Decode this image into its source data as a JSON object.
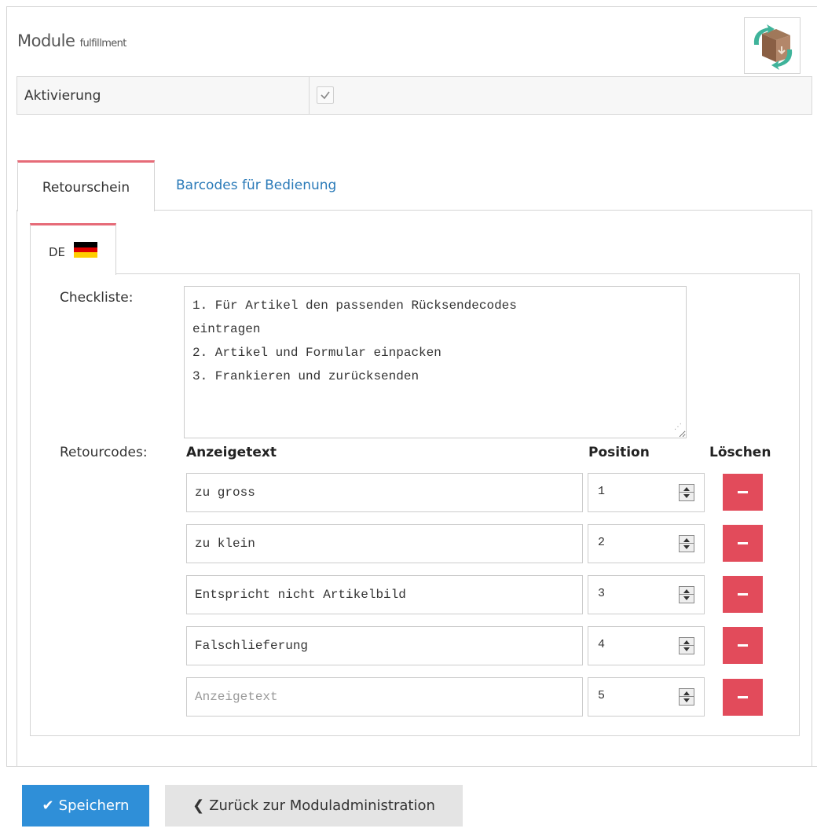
{
  "header": {
    "title": "Module",
    "subtitle": "fulfillment",
    "logo_icon": "package-return-icon"
  },
  "activation": {
    "label": "Aktivierung",
    "checked": true,
    "check_glyph": "✓"
  },
  "tabs": [
    {
      "label": "Retourschein",
      "active": true
    },
    {
      "label": "Barcodes für Bedienung",
      "active": false
    }
  ],
  "language_tab": {
    "label": "DE",
    "flag_colors": [
      "#000000",
      "#dd0000",
      "#ffce00"
    ]
  },
  "checklist": {
    "label": "Checkliste:",
    "value": "1. Für Artikel den passenden Rücksendecodes\neintragen\n2. Artikel und Formular einpacken\n3. Frankieren und zurücksenden"
  },
  "retourcodes": {
    "label": "Retourcodes:",
    "columns": {
      "text": "Anzeigetext",
      "position": "Position",
      "delete": "Löschen"
    },
    "rows": [
      {
        "text": "zu gross",
        "placeholder": "Anzeigetext",
        "position": "1"
      },
      {
        "text": "zu klein",
        "placeholder": "Anzeigetext",
        "position": "2"
      },
      {
        "text": "Entspricht nicht Artikelbild",
        "placeholder": "Anzeigetext",
        "position": "3"
      },
      {
        "text": "Falschlieferung",
        "placeholder": "Anzeigetext",
        "position": "4"
      },
      {
        "text": "",
        "placeholder": "Anzeigetext",
        "position": "5"
      }
    ]
  },
  "actions": {
    "save_label": "Speichern",
    "save_icon": "✔",
    "back_label": "Zurück zur Moduladministration",
    "back_icon": "❮"
  },
  "colors": {
    "accent_tab": "#e66b78",
    "link": "#2a7ab8",
    "save_button": "#2f8fd8",
    "delete_button": "#e24b5b"
  }
}
